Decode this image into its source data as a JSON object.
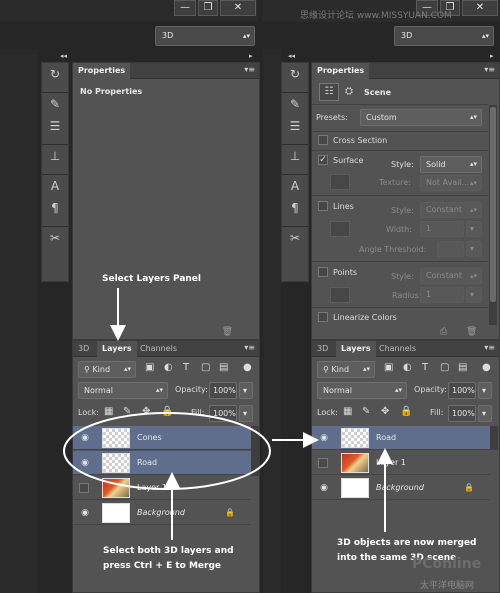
{
  "left": {
    "window_buttons": [
      "—",
      "❐",
      "✕"
    ],
    "workspace": "3D",
    "properties_tab": "Properties",
    "properties_text": "No Properties",
    "tabs": [
      "3D",
      "Layers",
      "Channels"
    ],
    "filter_kind": "Kind",
    "blend_mode": "Normal",
    "opacity_label": "Opacity:",
    "opacity_value": "100%",
    "lock_label": "Lock:",
    "fill_label": "Fill:",
    "fill_value": "100%",
    "layers": [
      {
        "name": "Cones",
        "selected": true
      },
      {
        "name": "Road",
        "selected": true
      },
      {
        "name": "Layer 1",
        "selected": false
      },
      {
        "name": "Background",
        "selected": false
      }
    ]
  },
  "right": {
    "window_buttons": [
      "—",
      "❐",
      "✕"
    ],
    "workspace": "3D",
    "properties_tab": "Properties",
    "scene_label": "Scene",
    "presets_label": "Presets:",
    "presets_value": "Custom",
    "cross_section": "Cross Section",
    "surface": "Surface",
    "style_label": "Style:",
    "surface_style": "Solid",
    "texture_label": "Texture:",
    "texture_value": "Not Avail...",
    "lines": "Lines",
    "lines_style": "Constant",
    "width_label": "Width:",
    "width_value": "1",
    "angle_label": "Angle Threshold:",
    "points": "Points",
    "points_style": "Constant",
    "radius_label": "Radius:",
    "radius_value": "1",
    "linearize": "Linearize Colors",
    "tabs": [
      "3D",
      "Layers",
      "Channels"
    ],
    "filter_kind": "Kind",
    "blend_mode": "Normal",
    "opacity_label": "Opacity:",
    "opacity_value": "100%",
    "lock_label": "Lock:",
    "fill_label": "Fill:",
    "fill_value": "100%",
    "layers": [
      {
        "name": "Road",
        "selected": true
      },
      {
        "name": "Layer 1",
        "selected": false
      },
      {
        "name": "Background",
        "selected": false
      }
    ]
  },
  "annotations": {
    "select_layers_panel": "Select Layers Panel",
    "select_both_line1": "Select both 3D layers and",
    "select_both_line2": "press Ctrl + E to Merge",
    "merged_line1": "3D objects are now merged",
    "merged_line2": "into the same 3D scene"
  },
  "watermark_top": "思缘设计论坛 www.MISSYUAN.COM",
  "watermark_bottom": "太平洋电脑网",
  "watermark_logo": "PConline"
}
